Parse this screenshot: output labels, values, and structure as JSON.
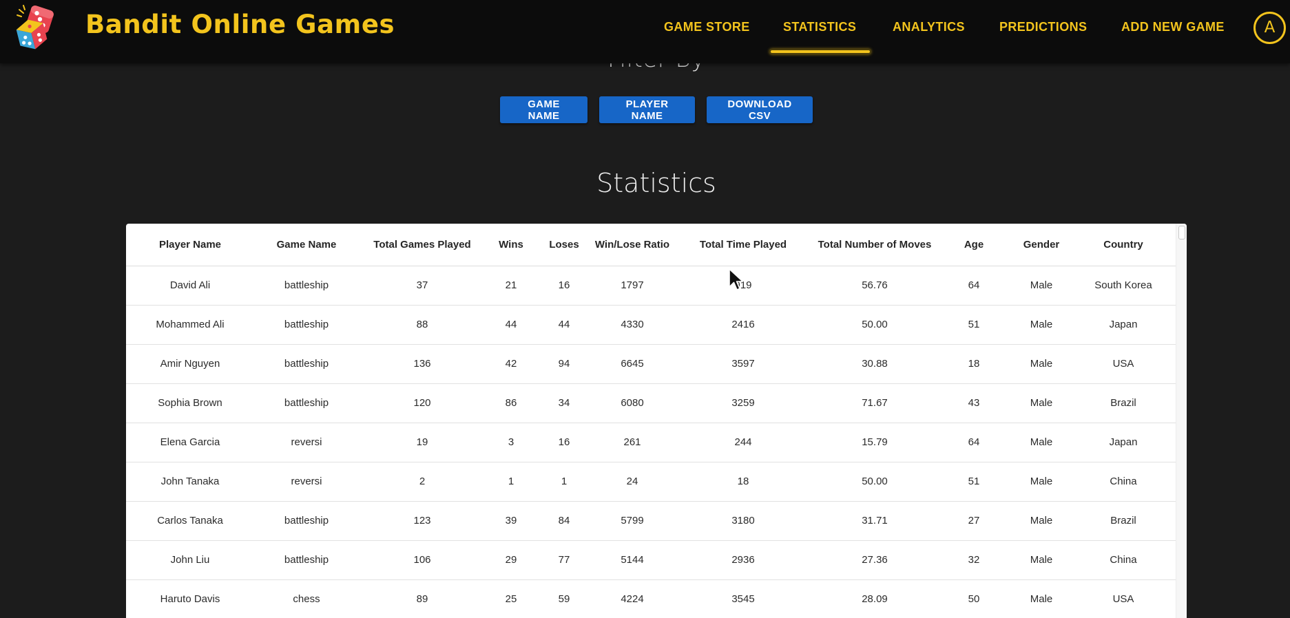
{
  "header": {
    "brand": "Bandit Online Games",
    "nav": [
      {
        "label": "GAME STORE",
        "active": false
      },
      {
        "label": "STATISTICS",
        "active": true
      },
      {
        "label": "ANALYTICS",
        "active": false
      },
      {
        "label": "PREDICTIONS",
        "active": false
      },
      {
        "label": "ADD NEW GAME",
        "active": false
      }
    ],
    "avatar_initial": "A",
    "logo_icon": "dice-icon"
  },
  "filter": {
    "heading": "Filter By",
    "buttons": {
      "game_name": "GAME NAME",
      "player_name": "PLAYER NAME",
      "download_csv": "DOWNLOAD CSV"
    }
  },
  "statistics": {
    "title": "Statistics",
    "columns": [
      "Player Name",
      "Game Name",
      "Total Games Played",
      "Wins",
      "Loses",
      "Win/Lose Ratio",
      "Total Time Played",
      "Total Number of Moves",
      "Age",
      "Gender",
      "Country"
    ],
    "rows": [
      [
        "David Ali",
        "battleship",
        "37",
        "21",
        "16",
        "1797",
        "919",
        "56.76",
        "64",
        "Male",
        "South Korea"
      ],
      [
        "Mohammed Ali",
        "battleship",
        "88",
        "44",
        "44",
        "4330",
        "2416",
        "50.00",
        "51",
        "Male",
        "Japan"
      ],
      [
        "Amir Nguyen",
        "battleship",
        "136",
        "42",
        "94",
        "6645",
        "3597",
        "30.88",
        "18",
        "Male",
        "USA"
      ],
      [
        "Sophia Brown",
        "battleship",
        "120",
        "86",
        "34",
        "6080",
        "3259",
        "71.67",
        "43",
        "Male",
        "Brazil"
      ],
      [
        "Elena Garcia",
        "reversi",
        "19",
        "3",
        "16",
        "261",
        "244",
        "15.79",
        "64",
        "Male",
        "Japan"
      ],
      [
        "John Tanaka",
        "reversi",
        "2",
        "1",
        "1",
        "24",
        "18",
        "50.00",
        "51",
        "Male",
        "China"
      ],
      [
        "Carlos Tanaka",
        "battleship",
        "123",
        "39",
        "84",
        "5799",
        "3180",
        "31.71",
        "27",
        "Male",
        "Brazil"
      ],
      [
        "John Liu",
        "battleship",
        "106",
        "29",
        "77",
        "5144",
        "2936",
        "27.36",
        "32",
        "Male",
        "China"
      ],
      [
        "Haruto Davis",
        "chess",
        "89",
        "25",
        "59",
        "4224",
        "3545",
        "28.09",
        "50",
        "Male",
        "USA"
      ]
    ]
  },
  "colors": {
    "accent": "#f3c41d",
    "button": "#1766c7",
    "background": "#1c1c1c",
    "header": "#0c0c0c"
  }
}
